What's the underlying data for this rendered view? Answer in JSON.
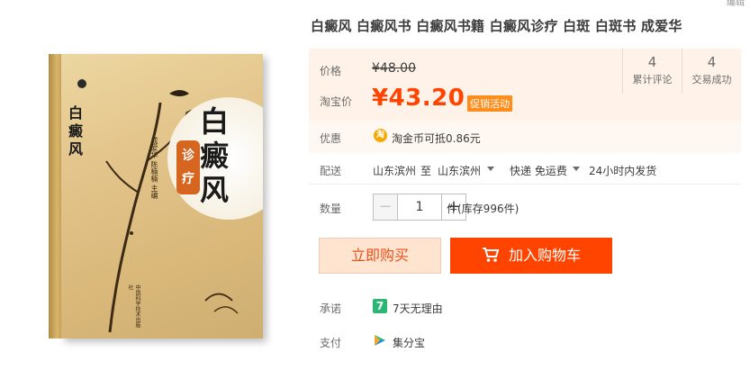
{
  "product": {
    "title": "白癜风 白癜风书 白癜风书籍 白癜风诊疗 白斑 白斑书 成爱华",
    "cover": {
      "title_main": "白癜风",
      "title_small": "白癜风",
      "stamp": "诊疗",
      "authors": "成爱华 陈楠楠 主编",
      "publisher": "中国科学技术出版社"
    }
  },
  "price": {
    "label": "价格",
    "original": "¥48.00",
    "taobao_label": "淘宝价",
    "current": "¥43.20",
    "promo": "促销活动",
    "color": "#ff4400"
  },
  "stats": [
    {
      "num": "4",
      "label": "累计评论"
    },
    {
      "num": "4",
      "label": "交易成功"
    }
  ],
  "discount": {
    "label": "优惠",
    "coin_icon": "淘",
    "text": "淘金币可抵0.86元"
  },
  "shipping": {
    "label": "配送",
    "origin": "山东滨州",
    "to": "至",
    "destination": "山东滨州",
    "method": "快递 免运费",
    "time": "24小时内发货"
  },
  "quantity": {
    "label": "数量",
    "value": "1",
    "minus": "−",
    "plus": "+",
    "stock": "件(库存996件)"
  },
  "actions": {
    "buy_now": "立即购买",
    "add_cart": "加入购物车"
  },
  "promise": {
    "label": "承诺",
    "icon": "7",
    "text": "7天无理由"
  },
  "payment": {
    "label": "支付",
    "text": "集分宝"
  },
  "corner_text": "编辑"
}
